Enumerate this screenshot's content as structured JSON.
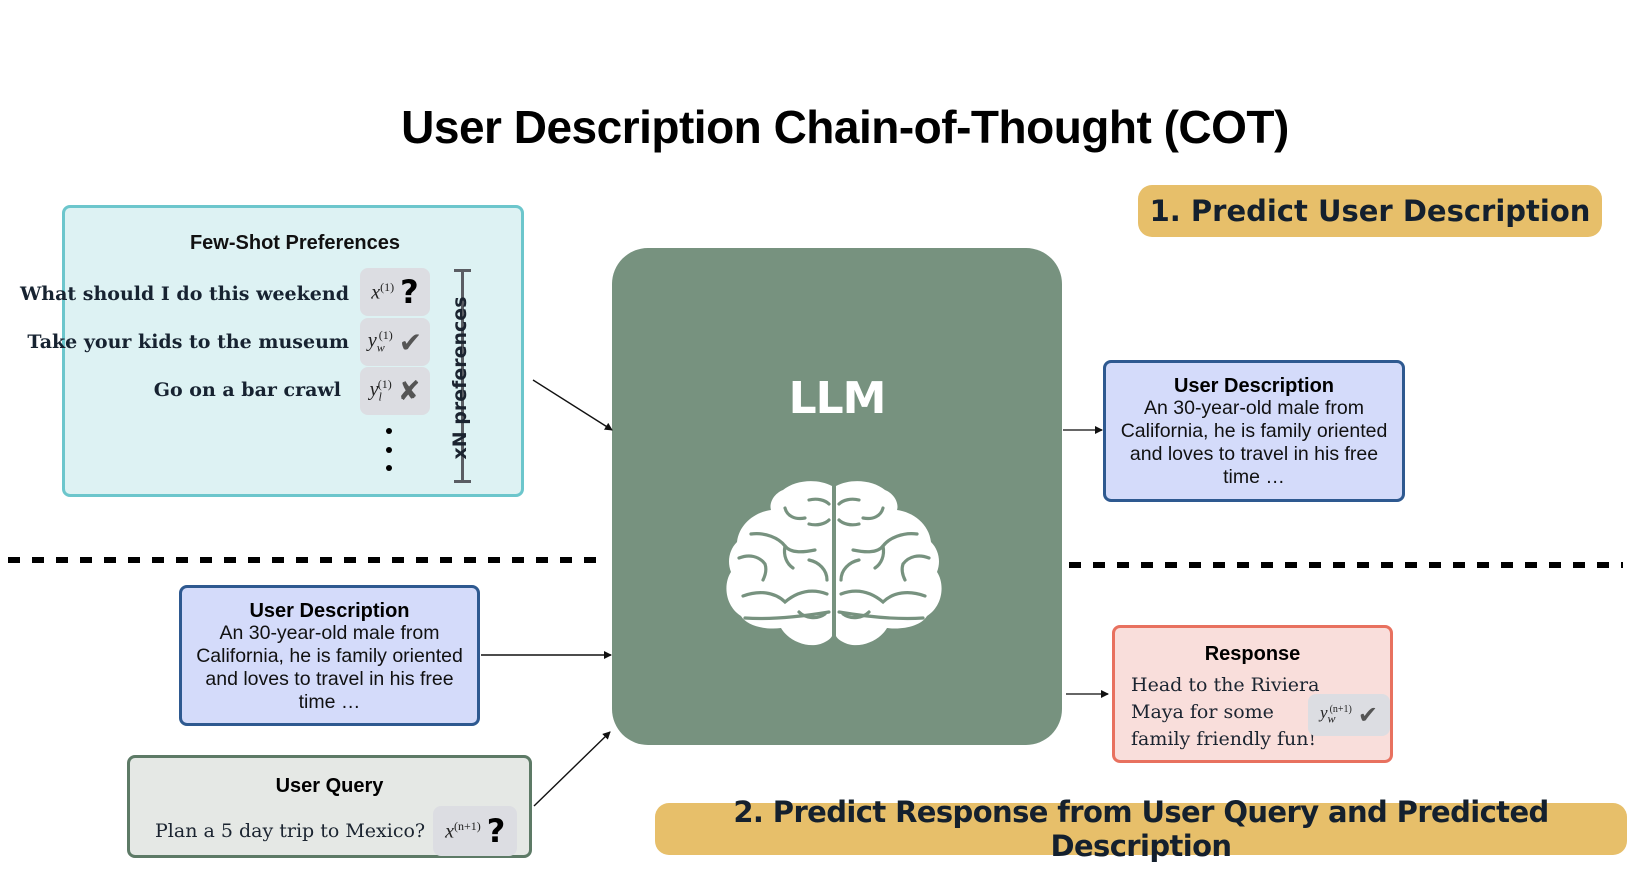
{
  "title": "User Description Chain-of-Thought (COT)",
  "steps": {
    "step1": "1. Predict User Description",
    "step2": "2. Predict Response from User Query and Predicted Description"
  },
  "few_shot": {
    "title": "Few-Shot Preferences",
    "items": [
      {
        "text": "What should I do this weekend",
        "symbol": "x",
        "sub": "",
        "sup": "(1)",
        "icon": "question-icon",
        "glyph": "?"
      },
      {
        "text": "Take your kids to the museum",
        "symbol": "y",
        "sub": "w",
        "sup": "(1)",
        "icon": "check-icon",
        "glyph": "✔"
      },
      {
        "text": "Go on a bar crawl",
        "symbol": "y",
        "sub": "l",
        "sup": "(1)",
        "icon": "cross-icon",
        "glyph": "✘"
      }
    ],
    "bracket_label": "xN preferences"
  },
  "llm": {
    "label": "LLM",
    "icon": "brain-icon",
    "color": "#77927f"
  },
  "predicted_description": {
    "title": "User Description",
    "body": "An 30-year-old male from California, he is family oriented and loves to travel in his free time …"
  },
  "input_description": {
    "title": "User Description",
    "body": "An 30-year-old male from California, he is family oriented and loves to travel in his free time …"
  },
  "user_query": {
    "title": "User Query",
    "text": "Plan a 5 day trip to Mexico?",
    "symbol": "x",
    "sup": "(n+1)",
    "glyph": "?"
  },
  "response": {
    "title": "Response",
    "lines": [
      "Head to the Riviera",
      "Maya for some",
      "family friendly fun!"
    ],
    "symbol": "y",
    "sub": "w",
    "sup": "(n+1)",
    "glyph": "✔"
  },
  "colors": {
    "badge": "#e7bf6a",
    "fewshot_bg": "#ddf2f3",
    "fewshot_border": "#6cc6cc",
    "description_bg": "#d4dbfa",
    "description_border": "#2e5990",
    "query_bg": "#e5e8e5",
    "query_border": "#5d7a66",
    "response_bg": "#f9dedb",
    "response_border": "#e8715f"
  }
}
